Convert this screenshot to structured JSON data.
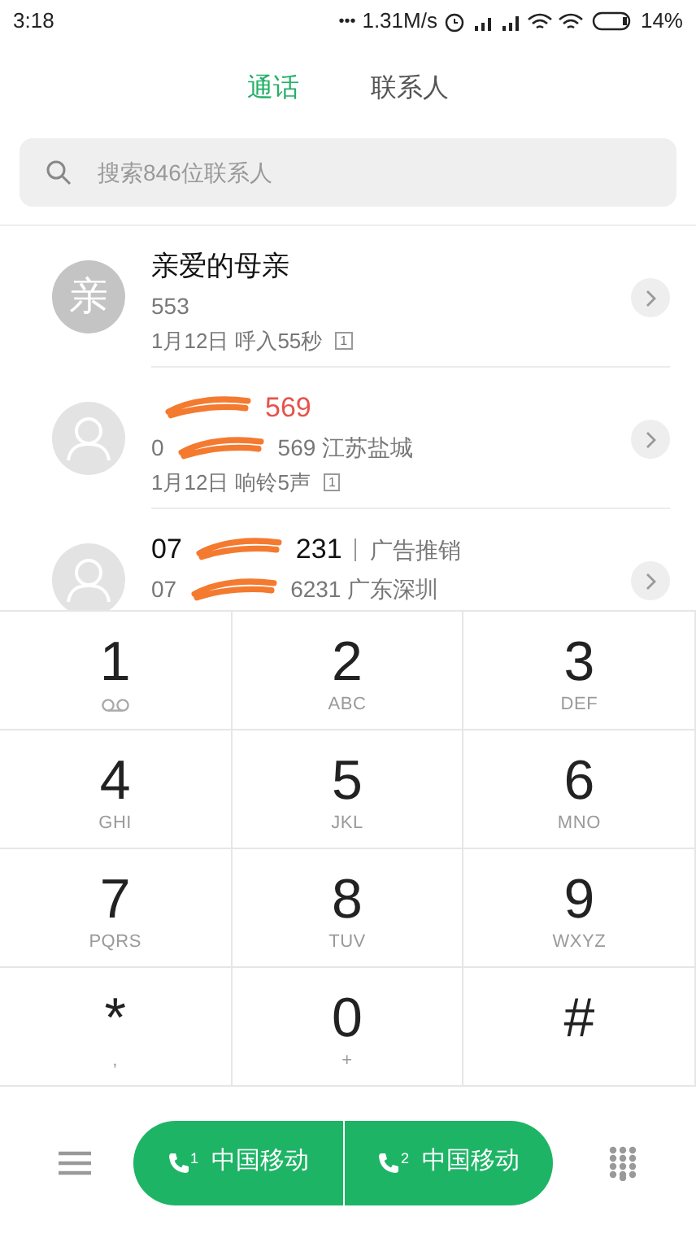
{
  "status_bar": {
    "time": "3:18",
    "more": "•••",
    "speed": "1.31M/s",
    "battery": "14%"
  },
  "tabs": [
    {
      "label": "通话",
      "selected": true
    },
    {
      "label": "联系人",
      "selected": false
    }
  ],
  "search": {
    "placeholder": "搜索846位联系人"
  },
  "calls": [
    {
      "avatar": {
        "kind": "letter",
        "text": "亲"
      },
      "missed": false,
      "title": [
        {
          "kind": "text",
          "text": "亲爱的母亲"
        }
      ],
      "number": [
        {
          "kind": "text",
          "text": "553"
        }
      ],
      "date": "1月12日",
      "detail": "呼入55秒",
      "sim": "1"
    },
    {
      "avatar": {
        "kind": "silhouette"
      },
      "missed": true,
      "title": [
        {
          "kind": "redaction"
        },
        {
          "kind": "text",
          "text": "569"
        }
      ],
      "number": [
        {
          "kind": "text",
          "text": "0"
        },
        {
          "kind": "redaction"
        },
        {
          "kind": "text",
          "text": "569 江苏盐城"
        }
      ],
      "date": "1月12日",
      "detail": "响铃5声",
      "sim": "1"
    },
    {
      "avatar": {
        "kind": "silhouette"
      },
      "missed": false,
      "title": [
        {
          "kind": "text",
          "text": "07"
        },
        {
          "kind": "redaction"
        },
        {
          "kind": "text",
          "text": "231"
        }
      ],
      "tag": "广告推销",
      "number": [
        {
          "kind": "text",
          "text": "07"
        },
        {
          "kind": "redaction"
        },
        {
          "kind": "text",
          "text": "6231 广东深圳"
        }
      ]
    }
  ],
  "keypad": [
    {
      "digit": "1",
      "kind": "voicemail"
    },
    {
      "digit": "2",
      "kind": "letters",
      "sub": "ABC"
    },
    {
      "digit": "3",
      "kind": "letters",
      "sub": "DEF"
    },
    {
      "digit": "4",
      "kind": "letters",
      "sub": "GHI"
    },
    {
      "digit": "5",
      "kind": "letters",
      "sub": "JKL"
    },
    {
      "digit": "6",
      "kind": "letters",
      "sub": "MNO"
    },
    {
      "digit": "7",
      "kind": "letters",
      "sub": "PQRS"
    },
    {
      "digit": "8",
      "kind": "letters",
      "sub": "TUV"
    },
    {
      "digit": "9",
      "kind": "letters",
      "sub": "WXYZ"
    },
    {
      "digit": "*",
      "kind": "letters",
      "sub": ","
    },
    {
      "digit": "0",
      "kind": "letters",
      "sub": "+"
    },
    {
      "digit": "#",
      "kind": "letters"
    }
  ],
  "dial_buttons": [
    {
      "sim": "1",
      "label": "中国移动"
    },
    {
      "sim": "2",
      "label": "中国移动"
    }
  ]
}
